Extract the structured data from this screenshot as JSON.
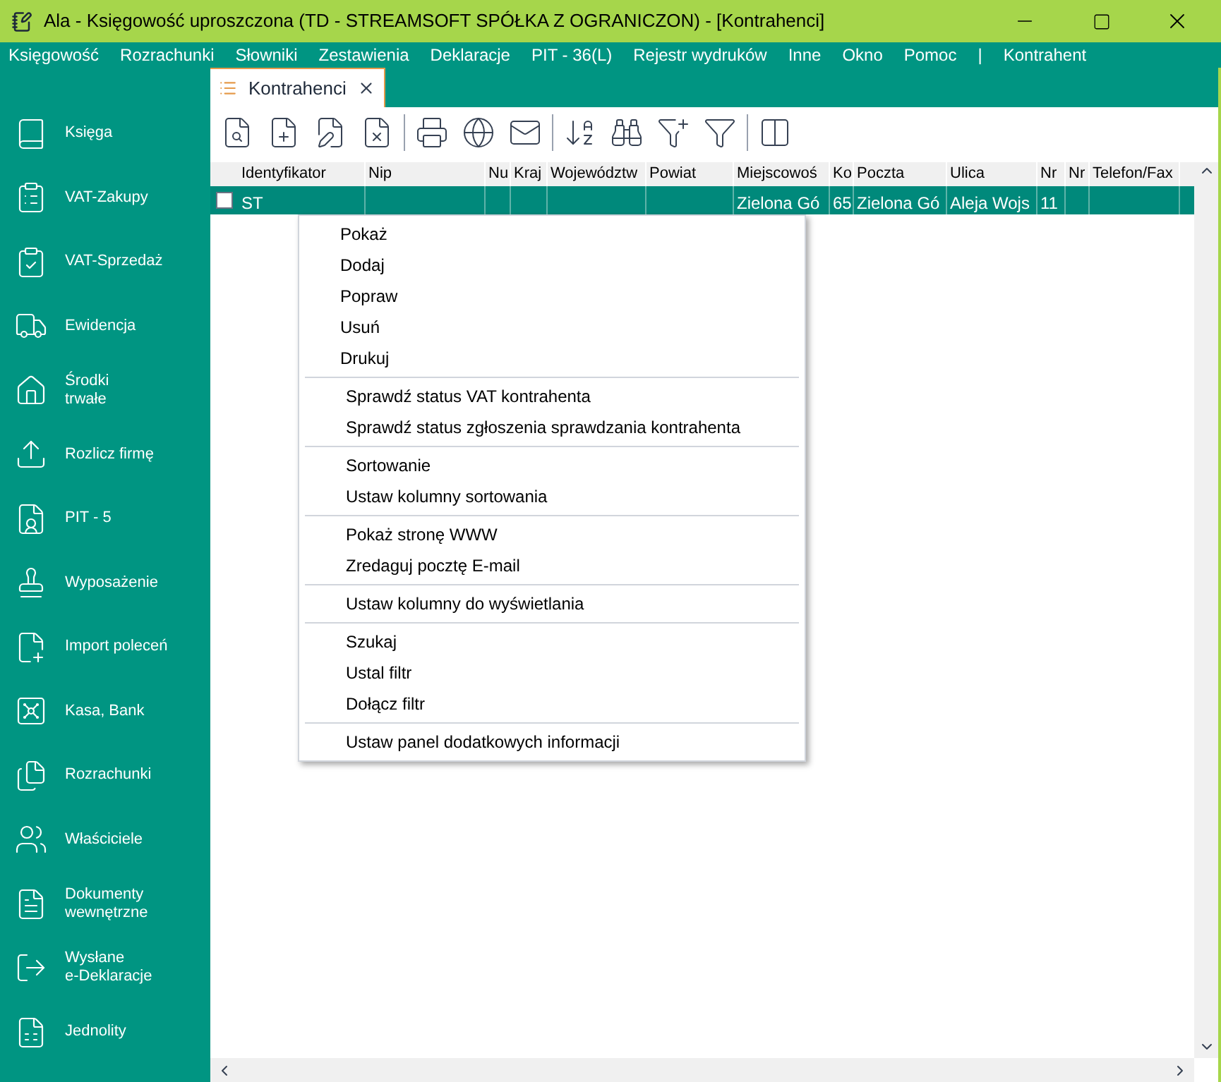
{
  "window": {
    "title": "Ala - Księgowość uproszczona (TD - STREAMSOFT  SPÓŁKA Z OGRANICZON) - [Kontrahenci]"
  },
  "menu_bar": [
    "Księgowość",
    "Rozrachunki",
    "Słowniki",
    "Zestawienia",
    "Deklaracje",
    "PIT - 36(L)",
    "Rejestr wydruków",
    "Inne",
    "Okno",
    "Pomoc",
    "|",
    "Kontrahent"
  ],
  "sidebar": {
    "items": [
      {
        "label": "Księga",
        "kind": "book"
      },
      {
        "label": "VAT-Zakupy",
        "kind": "clipboard-in"
      },
      {
        "label": "VAT-Sprzedaż",
        "kind": "clipboard-out"
      },
      {
        "label": "Ewidencja",
        "kind": "truck"
      },
      {
        "label": "Środki\ntrwałe",
        "kind": "house"
      },
      {
        "label": "Rozlicz firmę",
        "kind": "upload"
      },
      {
        "label": "PIT - 5",
        "kind": "person-doc"
      },
      {
        "label": "Wyposażenie",
        "kind": "stapler"
      },
      {
        "label": "Import poleceń",
        "kind": "import"
      },
      {
        "label": "Kasa, Bank",
        "kind": "safe"
      },
      {
        "label": "Rozrachunki",
        "kind": "docs"
      },
      {
        "label": "Właściciele",
        "kind": "users"
      },
      {
        "label": "Dokumenty\nwewnętrzne",
        "kind": "internal"
      },
      {
        "label": "Wysłane\ne-Deklaracje",
        "kind": "send"
      },
      {
        "label": "Jednolity",
        "kind": "jpk"
      }
    ]
  },
  "tabs": [
    {
      "label": "Kontrahenci",
      "selected": true
    }
  ],
  "table": {
    "columns": [
      "Identyfikator",
      "Nip",
      "Nu",
      "Kraj",
      "Województw",
      "Powiat",
      "Miejscowoś",
      "Ko",
      "Poczta",
      "Ulica",
      "Nr",
      "Nr",
      "Telefon/Fax"
    ],
    "rows": [
      {
        "selected": true,
        "checked": false,
        "cells": [
          "ST",
          null,
          null,
          null,
          null,
          null,
          "Zielona Gó",
          "65",
          "Zielona Gó",
          "Aleja Wojs",
          "11",
          null,
          null
        ]
      }
    ]
  },
  "context_menu": [
    [
      "Pokaż",
      "Dodaj",
      "Popraw",
      "Usuń",
      "Drukuj"
    ],
    [
      "Sprawdź status VAT kontrahenta",
      "Sprawdź status zgłoszenia sprawdzania kontrahenta"
    ],
    [
      "Sortowanie",
      "Ustaw kolumny sortowania"
    ],
    [
      "Pokaż stronę WWW",
      "Zredaguj pocztę E-mail"
    ],
    [
      "Ustaw kolumny do wyświetlania"
    ],
    [
      "Szukaj",
      "Ustal filtr",
      "Dołącz filtr"
    ],
    [
      "Ustaw panel dodatkowych informacji"
    ]
  ]
}
